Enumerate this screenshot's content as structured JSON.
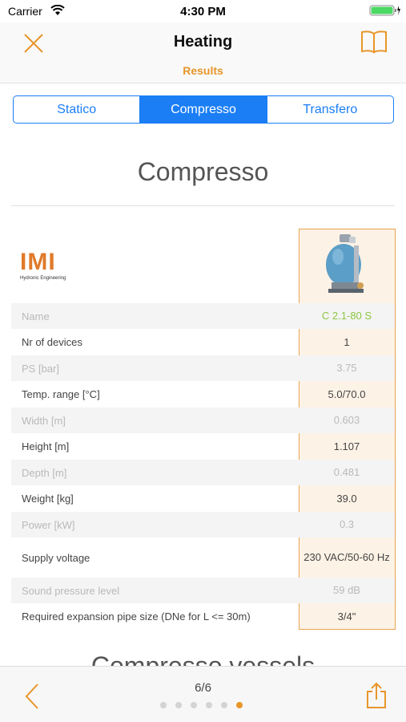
{
  "status_bar": {
    "carrier": "Carrier",
    "time": "4:30 PM",
    "icons": [
      "wifi-icon",
      "battery-icon"
    ]
  },
  "nav": {
    "title": "Heating",
    "subtitle": "Results",
    "left_icon": "close-icon",
    "right_icon": "book-icon"
  },
  "segments": [
    {
      "label": "Statico",
      "active": false
    },
    {
      "label": "Compresso",
      "active": true
    },
    {
      "label": "Transfero",
      "active": false
    }
  ],
  "section_title": "Compresso",
  "logo": {
    "text": "IMI",
    "subtext": "Hydronic Engineering"
  },
  "table": {
    "rows": [
      {
        "label": "Name",
        "value": "C 2.1-80 S"
      },
      {
        "label": "Nr of devices",
        "value": "1"
      },
      {
        "label": "PS [bar]",
        "value": "3.75"
      },
      {
        "label": "Temp. range [°C]",
        "value": "5.0/70.0"
      },
      {
        "label": "Width [m]",
        "value": "0.603"
      },
      {
        "label": "Height [m]",
        "value": "1.107"
      },
      {
        "label": "Depth [m]",
        "value": "0.481"
      },
      {
        "label": "Weight [kg]",
        "value": "39.0"
      },
      {
        "label": "Power [kW]",
        "value": "0.3"
      },
      {
        "label": "Supply voltage",
        "value": "230 VAC/50-60 Hz"
      },
      {
        "label": "Sound pressure level",
        "value": "59 dB"
      },
      {
        "label": "Required expansion pipe size (DNe for L <= 30m)",
        "value": "3/4\""
      }
    ]
  },
  "next_section_title": "Compresso vessels",
  "toolbar": {
    "page_label": "6/6",
    "page_count": 6,
    "current_page": 6,
    "back_icon": "chevron-left-icon",
    "share_icon": "share-icon"
  },
  "colors": {
    "accent": "#e8962a",
    "segment_blue": "#1b7ef5",
    "highlight_bg": "#fdf2e6",
    "highlight_border": "#e8a650",
    "name_green": "#8cc63f"
  }
}
